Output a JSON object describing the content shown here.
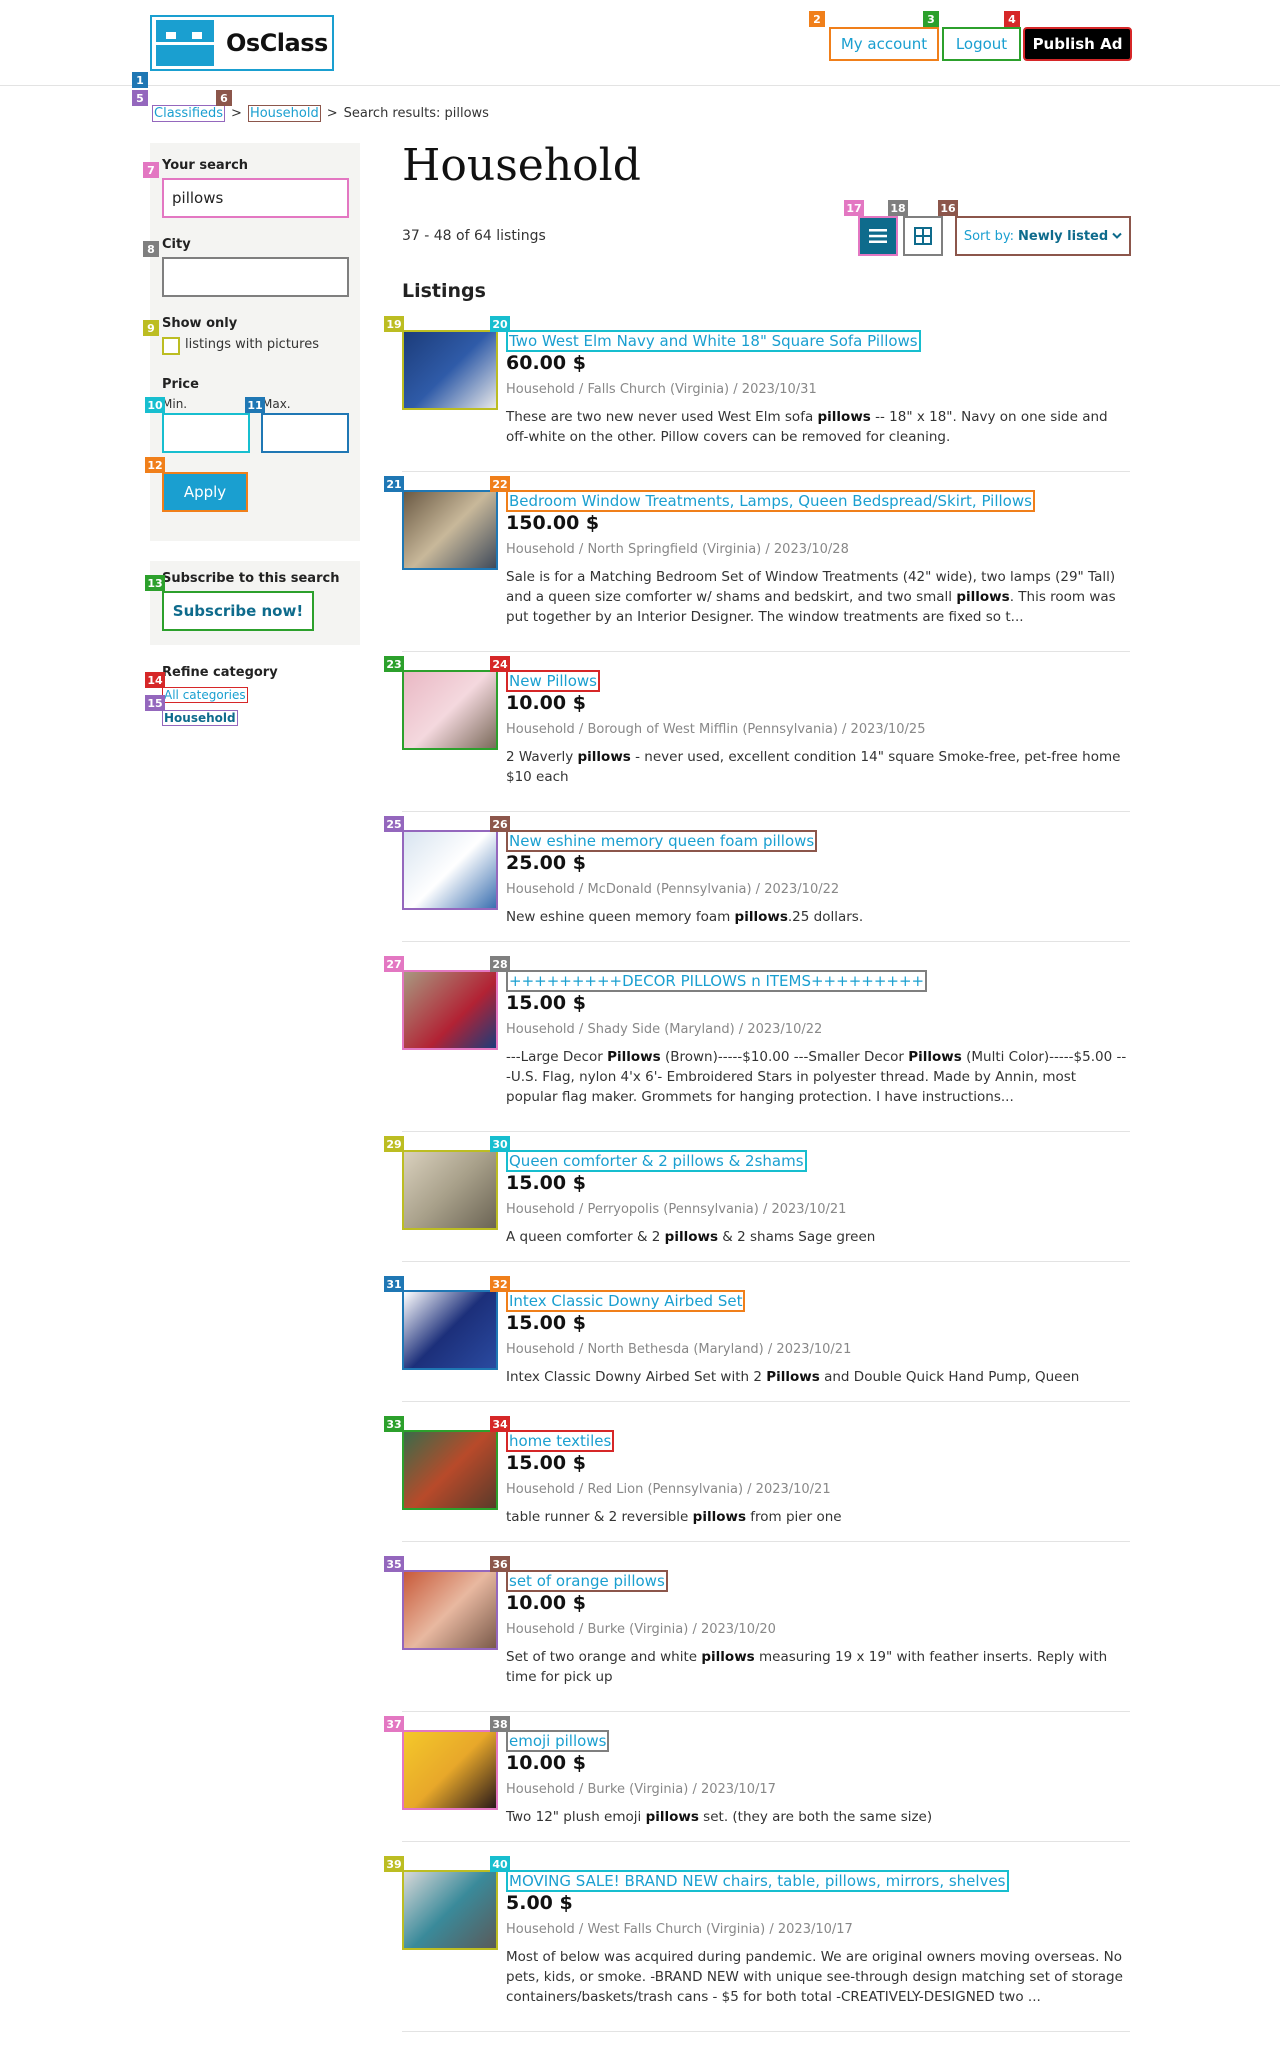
{
  "header": {
    "logo_text": "OsClass",
    "my_account": "My account",
    "logout": "Logout",
    "publish": "Publish Ad"
  },
  "breadcrumb": {
    "home": "Classifieds",
    "sep1": ">",
    "category": "Household",
    "sep2": ">",
    "current": "Search results: pillows"
  },
  "sidebar": {
    "search_label": "Your search",
    "search_value": "pillows",
    "city_label": "City",
    "city_value": "",
    "show_only_label": "Show only",
    "pictures_label": "listings with pictures",
    "price_label": "Price",
    "min_label": "Min.",
    "max_label": "Max.",
    "apply": "Apply",
    "subscribe_label": "Subscribe to this search",
    "subscribe_btn": "Subscribe now!",
    "refine_label": "Refine category",
    "all_categories": "All categories",
    "household": "Household"
  },
  "main": {
    "title": "Household",
    "count": "37 - 48 of 64 listings",
    "sort_prefix": "Sort by:",
    "sort_value": "Newly listed",
    "listings_heading": "Listings"
  },
  "badges": [
    "1",
    "2",
    "3",
    "4",
    "5",
    "6",
    "7",
    "8",
    "9",
    "10",
    "11",
    "12",
    "13",
    "14",
    "15",
    "16",
    "17",
    "18",
    "19",
    "20",
    "21",
    "22",
    "23",
    "24",
    "25",
    "26",
    "27",
    "28",
    "29",
    "30",
    "31",
    "32",
    "33",
    "34",
    "35",
    "36",
    "37",
    "38",
    "39",
    "40"
  ],
  "listings": [
    {
      "title": "Two West Elm Navy and White 18\" Square Sofa Pillows",
      "price": "60.00 $",
      "category": "Household",
      "location": "Falls Church (Virginia)",
      "date": "2023/10/31",
      "desc_html": "These are two new never used West Elm sofa <b>pillows</b> -- 18\" x 18\". Navy on one side and off-white on the other. Pillow covers can be removed for cleaning."
    },
    {
      "title": "Bedroom Window Treatments, Lamps, Queen Bedspread/Skirt, Pillows",
      "price": "150.00 $",
      "category": "Household",
      "location": "North Springfield (Virginia)",
      "date": "2023/10/28",
      "desc_html": "Sale is for a Matching Bedroom Set of Window Treatments (42\" wide), two lamps (29\" Tall) and a queen size comforter w/ shams and bedskirt, and two small <b>pillows</b>. This room was put together by an Interior Designer. The window treatments are fixed so t..."
    },
    {
      "title": "New Pillows",
      "price": "10.00 $",
      "category": "Household",
      "location": "Borough of West Mifflin (Pennsylvania)",
      "date": "2023/10/25",
      "desc_html": "2 Waverly <b>pillows</b> - never used, excellent condition 14\" square Smoke-free, pet-free home $10 each"
    },
    {
      "title": "New eshine memory queen foam pillows",
      "price": "25.00 $",
      "category": "Household",
      "location": "McDonald (Pennsylvania)",
      "date": "2023/10/22",
      "desc_html": "New eshine queen memory foam <b>pillows</b>.25 dollars."
    },
    {
      "title": "+++++++++DECOR PILLOWS n ITEMS+++++++++",
      "price": "15.00 $",
      "category": "Household",
      "location": "Shady Side (Maryland)",
      "date": "2023/10/22",
      "desc_html": "---Large Decor <b>Pillows</b> (Brown)-----$10.00 ---Smaller Decor <b>Pillows</b> (Multi Color)-----$5.00 ---U.S. Flag, nylon 4'x 6'- Embroidered Stars in polyester thread. Made by Annin, most popular flag maker. Grommets for hanging protection. I have instructions..."
    },
    {
      "title": "Queen comforter & 2 pillows & 2shams",
      "price": "15.00 $",
      "category": "Household",
      "location": "Perryopolis (Pennsylvania)",
      "date": "2023/10/21",
      "desc_html": "A queen comforter & 2 <b>pillows</b> & 2 shams Sage green"
    },
    {
      "title": "Intex Classic Downy Airbed Set",
      "price": "15.00 $",
      "category": "Household",
      "location": "North Bethesda (Maryland)",
      "date": "2023/10/21",
      "desc_html": "Intex Classic Downy Airbed Set with 2 <b>Pillows</b> and Double Quick Hand Pump, Queen"
    },
    {
      "title": "home textiles",
      "price": "15.00 $",
      "category": "Household",
      "location": "Red Lion (Pennsylvania)",
      "date": "2023/10/21",
      "desc_html": "table runner & 2 reversible <b>pillows</b> from pier one"
    },
    {
      "title": "set of orange pillows",
      "price": "10.00 $",
      "category": "Household",
      "location": "Burke (Virginia)",
      "date": "2023/10/20",
      "desc_html": "Set of two orange and white <b>pillows</b> measuring 19 x 19\" with feather inserts. Reply with time for pick up"
    },
    {
      "title": "emoji pillows",
      "price": "10.00 $",
      "category": "Household",
      "location": "Burke (Virginia)",
      "date": "2023/10/17",
      "desc_html": "Two 12\" plush emoji <b>pillows</b> set. (they are both the same size)"
    },
    {
      "title": "MOVING SALE! BRAND NEW chairs, table, pillows, mirrors, shelves",
      "price": "5.00 $",
      "category": "Household",
      "location": "West Falls Church (Virginia)",
      "date": "2023/10/17",
      "desc_html": "Most of below was acquired during pandemic. We are original owners moving overseas. No pets, kids, or smoke. -BRAND NEW with unique see-through design matching set of storage containers/baskets/trash cans - $5 for both total -CREATIVELY-DESIGNED two ..."
    }
  ]
}
